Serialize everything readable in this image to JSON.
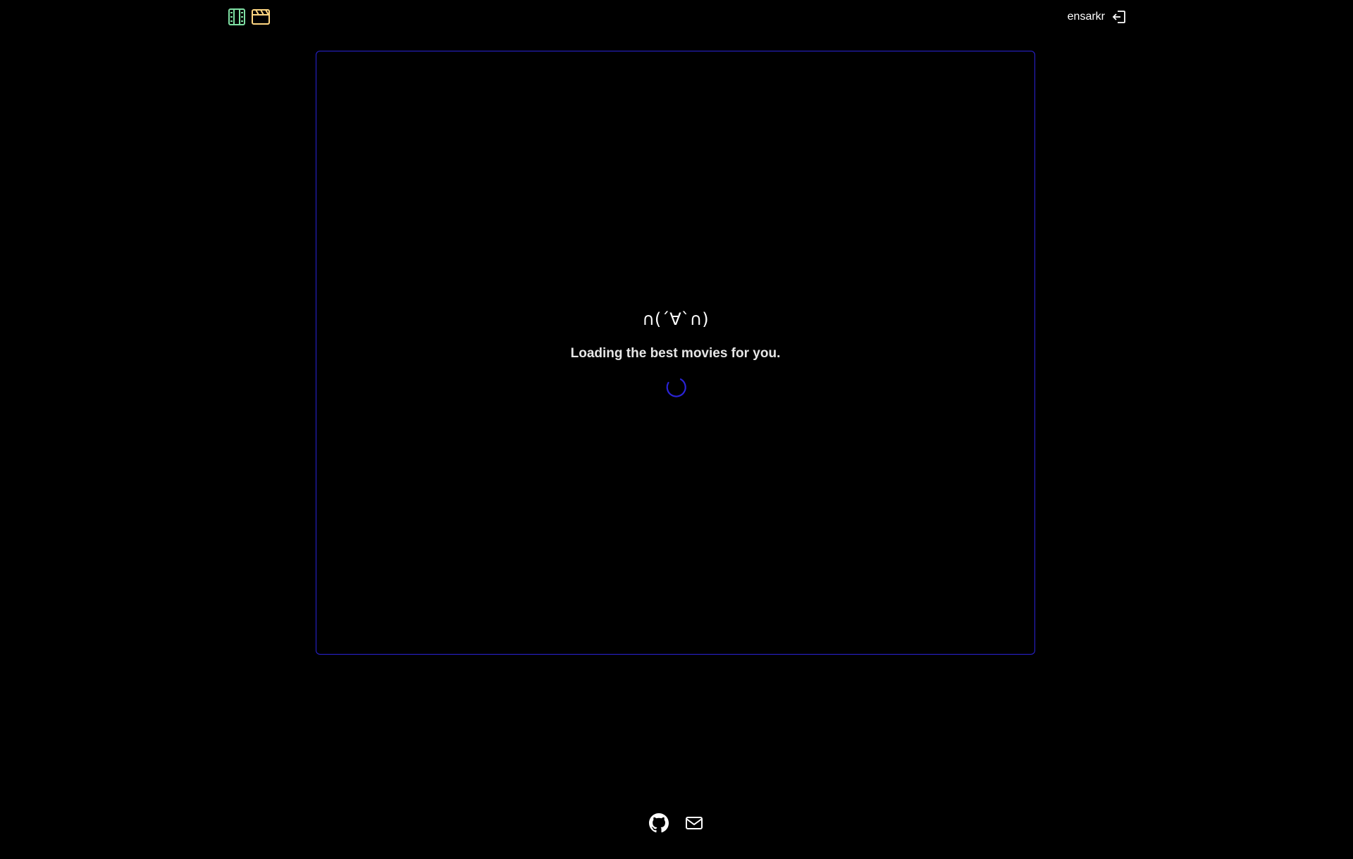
{
  "header": {
    "username": "ensarkr",
    "icons": {
      "left_primary": "film-strip-icon",
      "left_secondary": "clapperboard-icon",
      "logout": "logout-icon"
    },
    "colors": {
      "film_icon": "#7fe0a4",
      "clapper_icon": "#ffd782"
    }
  },
  "main": {
    "kaomoji": "∩(´∀`∩)",
    "loading_text": "Loading the best movies for you.",
    "spinner_color": "#2a23d6"
  },
  "footer": {
    "links": [
      {
        "icon": "github-icon"
      },
      {
        "icon": "mail-icon"
      }
    ]
  },
  "colors": {
    "background": "#000000",
    "accent": "#2a23d6"
  }
}
